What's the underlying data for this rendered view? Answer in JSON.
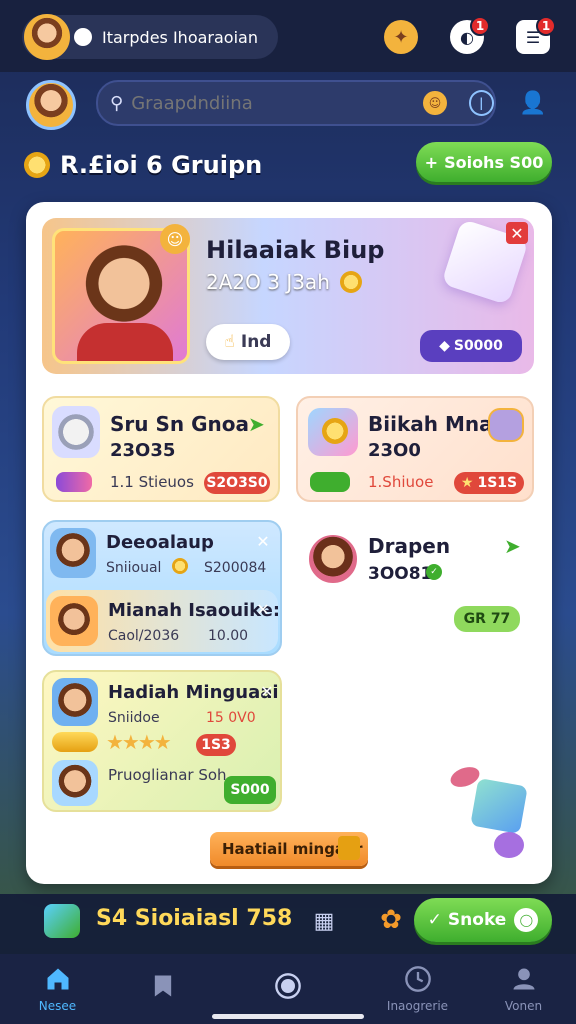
{
  "header": {
    "username": "Itarpdes Ihoaraoian",
    "coin_badge": "1",
    "inbox_badge": "1"
  },
  "search": {
    "placeholder": "Graapdndiina"
  },
  "section": {
    "title": "R.£ioi 6 Gruipn",
    "cta": "Soiohs S00"
  },
  "featured": {
    "title": "Hilaaiak Biup",
    "subtitle": "2A2O 3 J3ah",
    "button": "Ind",
    "price": "S0000"
  },
  "cards": [
    {
      "title": "Sru Sn Gnoa",
      "value": "23O35",
      "meta": "1.1 Stieuos",
      "tag": "S2O3S0"
    },
    {
      "title": "Biikah Mnai",
      "value": "23O0",
      "meta": "1.Shiuoe",
      "tag": "1S1S"
    },
    {
      "title": "Deeoalaup",
      "sub_left": "Sniioual",
      "sub_right": "S200084"
    },
    {
      "title": "Drapen",
      "value": "3OO81"
    },
    {
      "title": "Mianah Isaouike:",
      "sub_left": "Caol/2036",
      "sub_right": "10.00"
    },
    {
      "title": "Hadiah Minguaai",
      "sub_left": "Sniidoe",
      "sub_right": "15 0V0",
      "tag": "1S3",
      "extra": "Pruoglianar Soh",
      "price": "S000"
    }
  ],
  "drapen_tag": "GR 77",
  "weekly_button": "Haatiail mingaar",
  "bottom": {
    "balance": "S4 Sioiaiasl 758",
    "action": "Snoke"
  },
  "nav": [
    {
      "label": "Nesee"
    },
    {
      "label": ""
    },
    {
      "label": ""
    },
    {
      "label": "Inaogrerie"
    },
    {
      "label": "Vonen"
    }
  ]
}
